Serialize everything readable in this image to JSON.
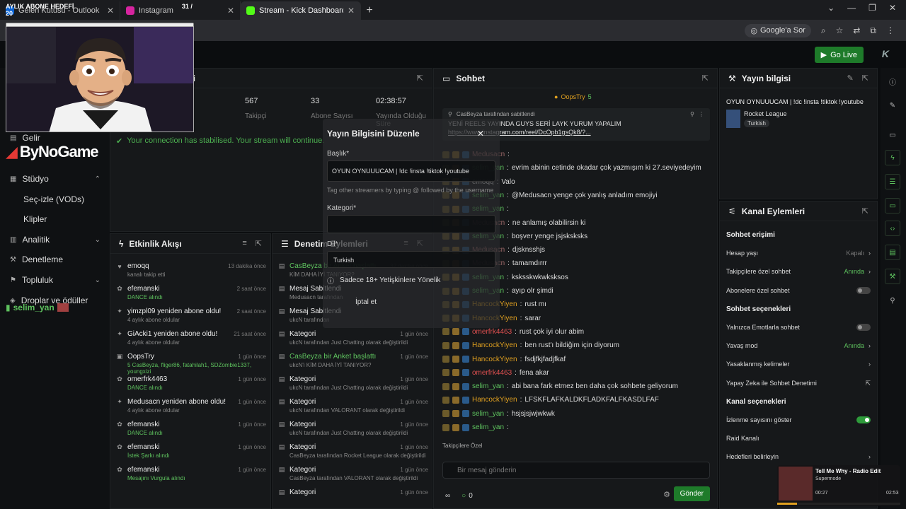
{
  "browser": {
    "tabs": [
      {
        "title": "Gelen Kutusu - Outlook",
        "fav": "#0a64d6",
        "active": false
      },
      {
        "title": "Instagram",
        "fav": "#d6249f",
        "active": false
      },
      {
        "title": "Stream - Kick Dashboard",
        "fav": "#53fc18",
        "active": true
      }
    ],
    "ask_google": "Google'a Sor"
  },
  "overlay": {
    "sub_goal_label": "AYLIK ABONE HEDEFİ",
    "sub_goal_count": "31 / 20",
    "sub_goal_progress": 1.0,
    "logo_text": "ByNoGame",
    "viewer_name": "selim_yan",
    "music": {
      "title": "Tell Me Why - Radio Edit",
      "artist": "Supermode",
      "elapsed": "00:27",
      "duration": "02:53",
      "progress": 0.16
    }
  },
  "appbar": {
    "go_live": "Go Live"
  },
  "sidebar": {
    "items": [
      {
        "label": "Gelir",
        "icon": "revenue-icon",
        "sub": false,
        "chev": false
      },
      {
        "label": "Stüdyo",
        "icon": "studio-icon",
        "sub": false,
        "chev": true
      },
      {
        "label": "Seç-izle (VODs)",
        "icon": "",
        "sub": true,
        "chev": false
      },
      {
        "label": "Klipler",
        "icon": "",
        "sub": true,
        "chev": false
      },
      {
        "label": "Analitik",
        "icon": "analytics-icon",
        "sub": false,
        "chev": true
      },
      {
        "label": "Denetleme",
        "icon": "moderation-icon",
        "sub": false,
        "chev": false
      },
      {
        "label": "Topluluk",
        "icon": "community-icon",
        "sub": false,
        "chev": true
      },
      {
        "label": "Droplar ve ödüller",
        "icon": "drops-icon",
        "sub": false,
        "chev": false
      }
    ]
  },
  "stats": {
    "title": "ri",
    "cells": [
      {
        "value": "",
        "label": "ci"
      },
      {
        "value": "567",
        "label": "Takipçi"
      },
      {
        "value": "33",
        "label": "Abone Sayısı"
      },
      {
        "value": "02:38:57",
        "label": "Yayında Olduğu Süre"
      }
    ],
    "connection": "Your connection has stabilised. Your stream will continue."
  },
  "edit_modal": {
    "title": "Yayın Bilgisini Düzenle",
    "title_label": "Başlık*",
    "title_value": "OYUN OYNUUUCAM | !dc !insta !tiktok !youtube",
    "tag_hint": "Tag other streamers by typing @ followed by the username",
    "category_label": "Kategori*",
    "language_label": "Dil*",
    "language_value": "Turkish",
    "adult_label": "Sadece 18+ Yetişkinlere Yönelik",
    "cancel": "İptal et"
  },
  "activity": {
    "title": "Etkinlik Akışı",
    "items": [
      {
        "name": "emoqq",
        "sub": "kanalı takip etti",
        "green": false,
        "ago": "13 dakika önce",
        "icon": "heart-icon"
      },
      {
        "name": "efemanski",
        "sub": "DANCE alındı",
        "green": true,
        "ago": "2 saat önce",
        "icon": "reward-icon"
      },
      {
        "name": "yimzpl09 yeniden abone oldu!",
        "sub": "4 aylık abone oldular",
        "green": false,
        "ago": "2 saat önce",
        "icon": "star-icon"
      },
      {
        "name": "GiAcki1 yeniden abone oldu!",
        "sub": "4 aylık abone oldular",
        "green": false,
        "ago": "21 saat önce",
        "icon": "star-icon"
      },
      {
        "name": "OopsTry",
        "sub": "5 CasBeyza, fliger86, fatahilah1, SDZombie1337, youngxizi",
        "green": true,
        "ago": "1 gün önce",
        "icon": "gift-icon"
      },
      {
        "name": "omerfrk4463",
        "sub": "DANCE alındı",
        "green": true,
        "ago": "1 gün önce",
        "icon": "reward-icon"
      },
      {
        "name": "Medusacn yeniden abone oldu!",
        "sub": "4 aylık abone oldular",
        "green": false,
        "ago": "1 gün önce",
        "icon": "star-icon"
      },
      {
        "name": "efemanski",
        "sub": "DANCE alındı",
        "green": true,
        "ago": "1 gün önce",
        "icon": "reward-icon"
      },
      {
        "name": "efemanski",
        "sub": "İstek Şarkı alındı",
        "green": true,
        "ago": "1 gün önce",
        "icon": "reward-icon"
      },
      {
        "name": "efemanski",
        "sub": "Mesajını Vurgula alındı",
        "green": true,
        "ago": "1 gün önce",
        "icon": "reward-icon"
      }
    ]
  },
  "moderation": {
    "title": "Denetim Eylemleri",
    "items": [
      {
        "name": "CasBeyza bir Anket başlattı",
        "sub": "KİM DAHA İYİ TANIYOR?",
        "ago": "32 dakika önce",
        "green": true
      },
      {
        "name": "Mesaj Sabitlendi",
        "sub": "Medusacn tarafından",
        "ago": "",
        "green": false
      },
      {
        "name": "Mesaj Sabitlendi",
        "sub": "ukcN tarafından",
        "ago": "",
        "green": false
      },
      {
        "name": "Kategori",
        "sub": "ukcN tarafından Just Chatting olarak değiştirildi",
        "ago": "1 gün önce",
        "green": false
      },
      {
        "name": "CasBeyza bir Anket başlattı",
        "sub": "ukcN'i KİM DAHA İYİ TANIYOR?",
        "ago": "1 gün önce",
        "green": true
      },
      {
        "name": "Kategori",
        "sub": "ukcN tarafından Just Chatting olarak değiştirildi",
        "ago": "1 gün önce",
        "green": false
      },
      {
        "name": "Kategori",
        "sub": "ukcN tarafından VALORANT olarak değiştirildi",
        "ago": "1 gün önce",
        "green": false
      },
      {
        "name": "Kategori",
        "sub": "ukcN tarafından Just Chatting olarak değiştirildi",
        "ago": "1 gün önce",
        "green": false
      },
      {
        "name": "Kategori",
        "sub": "CasBeyza tarafından Rocket League olarak değiştirildi",
        "ago": "1 gün önce",
        "green": false
      },
      {
        "name": "Kategori",
        "sub": "CasBeyza tarafından VALORANT olarak değiştirildi",
        "ago": "1 gün önce",
        "green": false
      },
      {
        "name": "Kategori",
        "sub": "",
        "ago": "1 gün önce",
        "green": false
      }
    ]
  },
  "chat": {
    "title": "Sohbet",
    "top_gifter": "OopsTry",
    "top_gifter_count": "5",
    "pinned_by": "CasBeyza tarafından sabitlendi",
    "pinned_text": "YENİ REELS YAYINDA GUYS SERİ LAYK YURUM YAPALIM",
    "pinned_link": "https://www.instagram.com/reel/DcOpb1gsQk8/?...",
    "messages": [
      {
        "user": "Medusacn",
        "cls": "u2",
        "text": ""
      },
      {
        "user": "selim_yan",
        "cls": "u1",
        "text": "evrim abinin cetinde okadar çok yazmışım ki 27.seviyedeyim"
      },
      {
        "user": "emoqq",
        "cls": "u5",
        "text": "Valo"
      },
      {
        "user": "selim_yan",
        "cls": "u1",
        "text": "@Medusacn yenge çok yanlış anladım emojiyi"
      },
      {
        "user": "selim_yan",
        "cls": "u1",
        "text": ""
      },
      {
        "user": "Medusacn",
        "cls": "u2",
        "text": "ne anlamış olabilirsin ki"
      },
      {
        "user": "selim_yan",
        "cls": "u1",
        "text": "boşver yenge jsjsksksks"
      },
      {
        "user": "Medusacn",
        "cls": "u2",
        "text": "djsknsshjs"
      },
      {
        "user": "Medusacn",
        "cls": "u2",
        "text": "tamamdırrr"
      },
      {
        "user": "selim_yan",
        "cls": "u1",
        "text": "ksksskwkwksksos"
      },
      {
        "user": "selim_yan",
        "cls": "u1",
        "text": "ayıp olr şimdi"
      },
      {
        "user": "HancockYiyen",
        "cls": "u3",
        "text": "rust mı"
      },
      {
        "user": "HancockYiyen",
        "cls": "u3",
        "text": "sarar"
      },
      {
        "user": "omerfrk4463",
        "cls": "u4",
        "text": "rust çok iyi olur abim"
      },
      {
        "user": "HancockYiyen",
        "cls": "u3",
        "text": "ben rust'ı bildiğim için diyorum"
      },
      {
        "user": "HancockYiyen",
        "cls": "u3",
        "text": "fsdjfkjfadjfkaf"
      },
      {
        "user": "omerfrk4463",
        "cls": "u4",
        "text": "fena akar"
      },
      {
        "user": "selim_yan",
        "cls": "u1",
        "text": "abi bana fark etmez ben daha çok sohbete geliyorum"
      },
      {
        "user": "HancockYiyen",
        "cls": "u3",
        "text": "LFSKFLAFKALDKFLADKFALFKASDLFAF"
      },
      {
        "user": "selim_yan",
        "cls": "u1",
        "text": "hsjsjsjwjwkwk"
      },
      {
        "user": "selim_yan",
        "cls": "u1",
        "text": ""
      }
    ],
    "followers_only": "Takipçilere Özel",
    "input_placeholder": "Bir mesaj gönderin",
    "points": "0",
    "send": "Gönder"
  },
  "stream_info": {
    "title": "Yayın bilgisi",
    "stream_title": "OYUN OYNUUUCAM | !dc !insta !tiktok !youtube",
    "category": "Rocket League",
    "language": "Turkish"
  },
  "channel_actions": {
    "title": "Kanal Eylemleri",
    "rows": [
      {
        "label": "Sohbet erişimi",
        "type": "header",
        "value": ""
      },
      {
        "label": "Hesap yaşı",
        "type": "link",
        "value": "Kapalı"
      },
      {
        "label": "Takipçilere özel sohbet",
        "type": "link",
        "value": "Anında"
      },
      {
        "label": "Abonelere özel sohbet",
        "type": "toggle",
        "value": "off"
      },
      {
        "label": "Sohbet seçenekleri",
        "type": "header",
        "value": ""
      },
      {
        "label": "Yalnızca Emotlarla sohbet",
        "type": "toggle",
        "value": "off"
      },
      {
        "label": "Yavaş mod",
        "type": "link",
        "value": "Anında"
      },
      {
        "label": "Yasaklanmış kelimeler",
        "type": "link",
        "value": ""
      },
      {
        "label": "Yapay Zeka ile Sohbet Denetimi",
        "type": "ext",
        "value": ""
      },
      {
        "label": "Kanal seçenekleri",
        "type": "header",
        "value": ""
      },
      {
        "label": "İzlenme sayısını göster",
        "type": "toggle",
        "value": "on"
      },
      {
        "label": "Raid Kanalı",
        "type": "plain",
        "value": ""
      },
      {
        "label": "Hedefleri belirleyin",
        "type": "link",
        "value": ""
      }
    ]
  },
  "colors": {
    "accent": "#53fc18",
    "go_live": "#1e7b2a",
    "panel": "#16181a"
  }
}
